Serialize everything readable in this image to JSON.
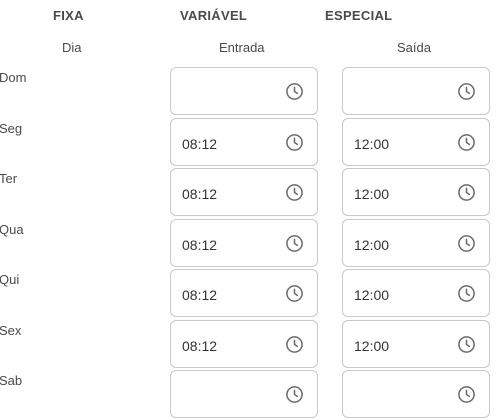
{
  "tabs": [
    {
      "label": "FIXA"
    },
    {
      "label": "VARIÁVEL"
    },
    {
      "label": "ESPECIAL"
    }
  ],
  "columns": {
    "day": "Dia",
    "entry": "Entrada",
    "exit": "Saída"
  },
  "rows": [
    {
      "day": "Dom",
      "entry": "",
      "exit": ""
    },
    {
      "day": "Seg",
      "entry": "08:12",
      "exit": "12:00"
    },
    {
      "day": "Ter",
      "entry": "08:12",
      "exit": "12:00"
    },
    {
      "day": "Qua",
      "entry": "08:12",
      "exit": "12:00"
    },
    {
      "day": "Qui",
      "entry": "08:12",
      "exit": "12:00"
    },
    {
      "day": "Sex",
      "entry": "08:12",
      "exit": "12:00"
    },
    {
      "day": "Sab",
      "entry": "",
      "exit": ""
    }
  ],
  "icons": {
    "time_picker": "clock-icon"
  },
  "colors": {
    "border": "#c9c9c9",
    "icon": "#6b6b6b",
    "text": "#333333"
  }
}
